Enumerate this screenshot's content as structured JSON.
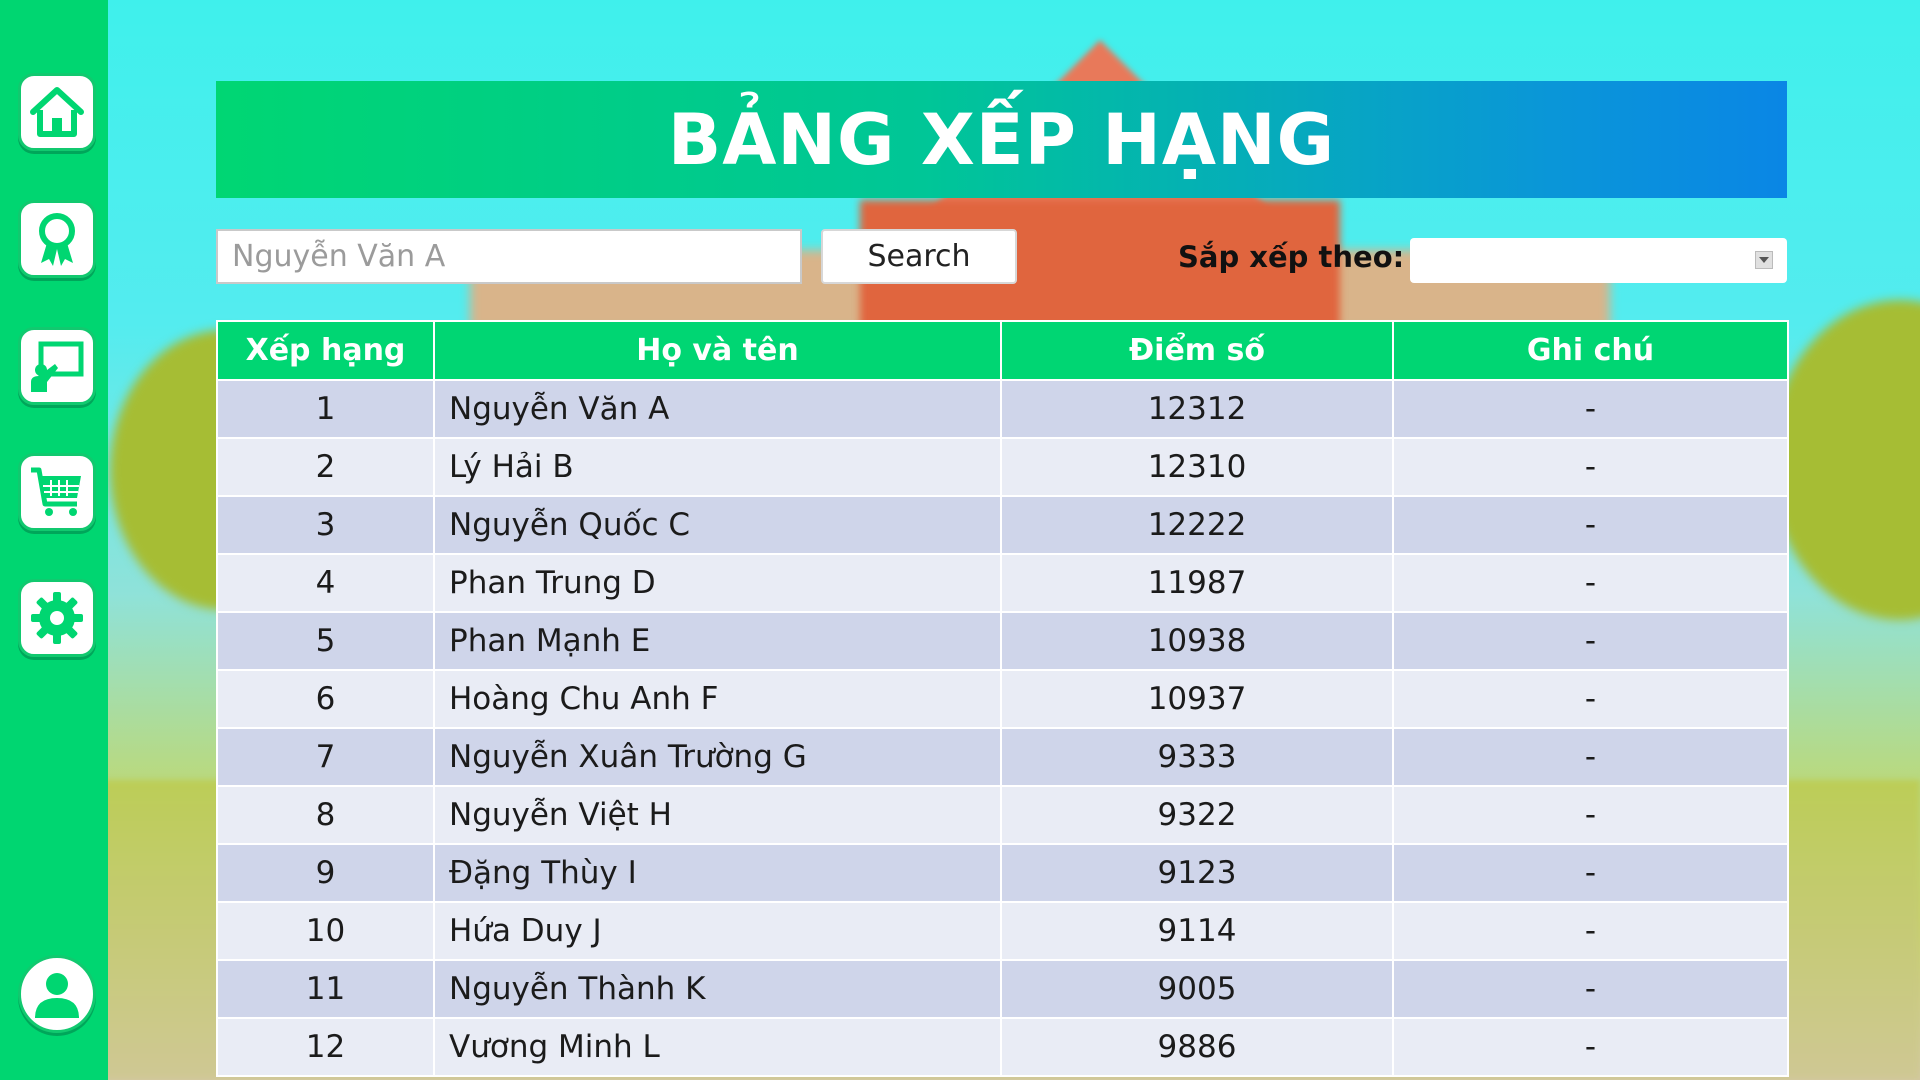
{
  "header": {
    "title": "BẢNG XẾP HẠNG"
  },
  "sidebar": {
    "items": [
      {
        "icon": "home-icon"
      },
      {
        "icon": "award-icon"
      },
      {
        "icon": "teacher-board-icon"
      },
      {
        "icon": "shopping-cart-icon"
      },
      {
        "icon": "gear-icon"
      },
      {
        "icon": "user-profile-icon"
      }
    ]
  },
  "search": {
    "placeholder": "Nguyễn Văn A",
    "value": "",
    "button_label": "Search"
  },
  "sort": {
    "label": "Sắp xếp theo:",
    "selected": ""
  },
  "table": {
    "headers": [
      "Xếp hạng",
      "Họ và tên",
      "Điểm số",
      "Ghi chú"
    ],
    "rows": [
      {
        "rank": "1",
        "name": "Nguyễn Văn A",
        "score": "12312",
        "note": "-"
      },
      {
        "rank": "2",
        "name": "Lý Hải B",
        "score": "12310",
        "note": "-"
      },
      {
        "rank": "3",
        "name": "Nguyễn Quốc C",
        "score": "12222",
        "note": "-"
      },
      {
        "rank": "4",
        "name": "Phan Trung D",
        "score": "11987",
        "note": "-"
      },
      {
        "rank": "5",
        "name": "Phan Mạnh E",
        "score": "10938",
        "note": "-"
      },
      {
        "rank": "6",
        "name": "Hoàng Chu Anh F",
        "score": "10937",
        "note": "-"
      },
      {
        "rank": "7",
        "name": "Nguyễn Xuân Trường G",
        "score": "9333",
        "note": "-"
      },
      {
        "rank": "8",
        "name": "Nguyễn Việt H",
        "score": "9322",
        "note": "-"
      },
      {
        "rank": "9",
        "name": "Đặng Thùy I",
        "score": "9123",
        "note": "-"
      },
      {
        "rank": "10",
        "name": "Hứa Duy J",
        "score": "9114",
        "note": "-"
      },
      {
        "rank": "11",
        "name": "Nguyễn Thành K",
        "score": "9005",
        "note": "-"
      },
      {
        "rank": "12",
        "name": "Vương Minh L",
        "score": "9886",
        "note": "-"
      }
    ]
  },
  "colors": {
    "accent_green": "#00d673",
    "header_blue": "#0a86e5",
    "row_odd": "#cfd5ea",
    "row_even": "#e9ecf5"
  }
}
